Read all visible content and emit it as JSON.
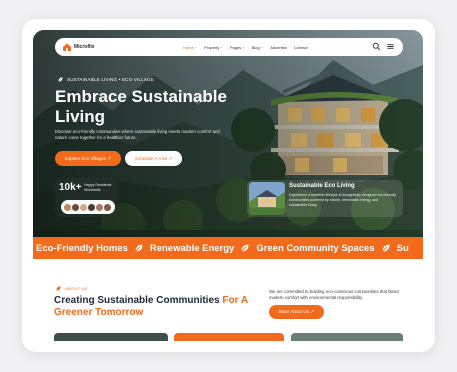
{
  "brand": {
    "name": "Microflix"
  },
  "nav": {
    "items": [
      {
        "label": "Home",
        "has_caret": true,
        "active": true
      },
      {
        "label": "Property",
        "has_caret": true,
        "active": false
      },
      {
        "label": "Pages",
        "has_caret": true,
        "active": false
      },
      {
        "label": "Blog",
        "has_caret": true,
        "active": false
      },
      {
        "label": "Advertise",
        "has_caret": false,
        "active": false
      },
      {
        "label": "Contact",
        "has_caret": false,
        "active": false
      }
    ],
    "caret": "⌄",
    "search_icon": "search-icon",
    "menu_icon": "hamburger-menu-icon"
  },
  "hero": {
    "kicker": "SUSTAINABLE LIVING • ECO VILLAGE",
    "title": "Embrace Sustainable Living",
    "description": "Discover eco-friendly communities where sustainable living meets modern comfort and nature come together for a healthier future.",
    "primary_button": "Explore Eco Villages ↗",
    "secondary_button": "Schedule A Visit ↗",
    "stats": {
      "number": "10k+",
      "label": "Happy Residents Worldwide"
    },
    "feature": {
      "title": "Sustainable Eco Living",
      "description": "Experience a healthier lifestyle in thoughtfully designed eco-friendly communities powered by nature, renewable energy, and sustainable living."
    }
  },
  "ticker": {
    "items": [
      "Eco-Friendly Homes",
      "Renewable Energy",
      "Green Community Spaces",
      "Su"
    ]
  },
  "about": {
    "tag": "ABOUT US",
    "title_main": "Creating Sustainable Communities ",
    "title_accent": "For A Greener Tomorrow",
    "description": "We are committed to building eco-conscious communities that blend modern comfort with environmental responsibility.",
    "button": "More About Us ↗"
  },
  "colors": {
    "accent": "#f26a1b",
    "heading": "#1d2a3a",
    "background": "#f1f1f4"
  }
}
